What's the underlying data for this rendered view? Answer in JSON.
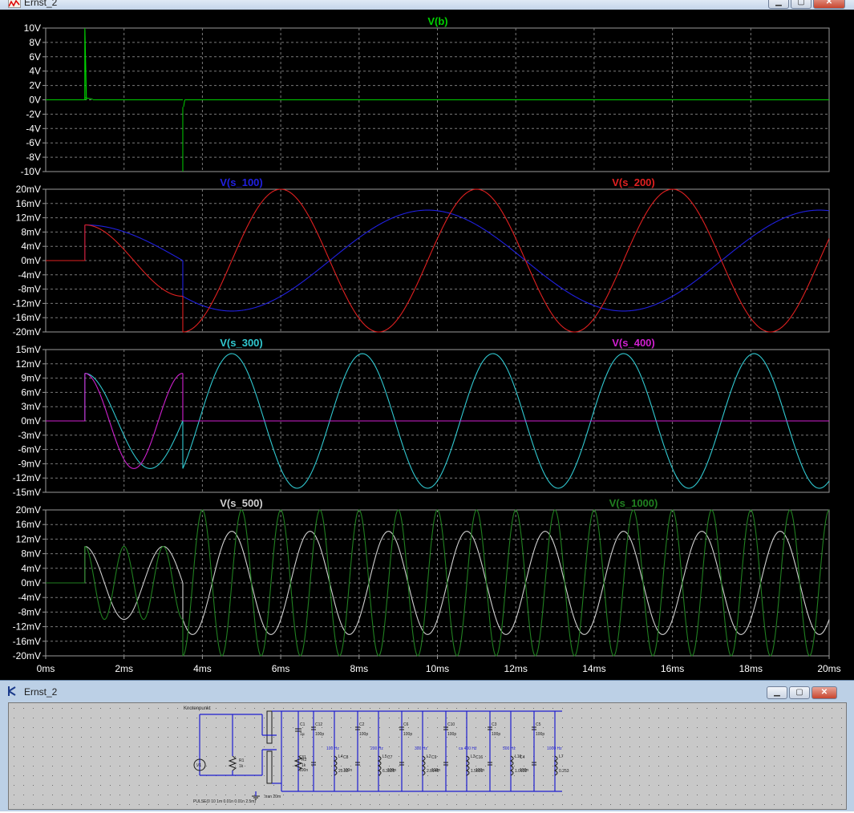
{
  "window": {
    "title": "Ernst_2"
  },
  "colors": {
    "v_b": "#00d000",
    "v_s_100": "#2020e0",
    "v_s_200": "#e02020",
    "v_s_300": "#30c8d0",
    "v_s_400": "#d020d0",
    "v_s_500": "#d0d0d0",
    "v_s_1000": "#208020",
    "grid": "#7a7a7a",
    "axis_text": "#ffffff"
  },
  "plot": {
    "x_axis": {
      "min": 0,
      "max": 20,
      "unit": "ms",
      "ticks": [
        "0ms",
        "2ms",
        "4ms",
        "6ms",
        "8ms",
        "10ms",
        "12ms",
        "14ms",
        "16ms",
        "18ms",
        "20ms"
      ]
    },
    "panes": [
      {
        "traces": [
          "V(b)"
        ],
        "y_ticks": [
          "10V",
          "8V",
          "6V",
          "4V",
          "2V",
          "0V",
          "-2V",
          "-4V",
          "-6V",
          "-8V",
          "-10V"
        ],
        "ylim": [
          -10,
          10
        ]
      },
      {
        "traces": [
          "V(s_100)",
          "V(s_200)"
        ],
        "y_ticks": [
          "20mV",
          "16mV",
          "12mV",
          "8mV",
          "4mV",
          "0mV",
          "-4mV",
          "-8mV",
          "-12mV",
          "-16mV",
          "-20mV"
        ],
        "ylim": [
          -20,
          20
        ]
      },
      {
        "traces": [
          "V(s_300)",
          "V(s_400)"
        ],
        "y_ticks": [
          "15mV",
          "12mV",
          "9mV",
          "6mV",
          "3mV",
          "0mV",
          "-3mV",
          "-6mV",
          "-9mV",
          "-12mV",
          "-15mV"
        ],
        "ylim": [
          -15,
          15
        ]
      },
      {
        "traces": [
          "V(s_500)",
          "V(s_1000)"
        ],
        "y_ticks": [
          "20mV",
          "16mV",
          "12mV",
          "8mV",
          "4mV",
          "0mV",
          "-4mV",
          "-8mV",
          "-12mV",
          "-16mV",
          "-20mV"
        ],
        "ylim": [
          -20,
          20
        ]
      }
    ]
  },
  "chart_data": {
    "type": "line",
    "x_unit": "ms",
    "xlim": [
      0,
      20
    ],
    "series": [
      {
        "name": "V(b)",
        "unit": "V",
        "description": "pulse 10V at 1ms, -10V spike at 3.5ms, otherwise 0V"
      },
      {
        "name": "V(s_100)",
        "unit": "mV",
        "peak": 14,
        "freq_hz": 100
      },
      {
        "name": "V(s_200)",
        "unit": "mV",
        "peak": 20,
        "freq_hz": 200
      },
      {
        "name": "V(s_300)",
        "unit": "mV",
        "peak": 14,
        "freq_hz": 300
      },
      {
        "name": "V(s_400)",
        "unit": "mV",
        "peak": 10,
        "freq_hz": 400
      },
      {
        "name": "V(s_500)",
        "unit": "mV",
        "peak": 14,
        "freq_hz": 500
      },
      {
        "name": "V(s_1000)",
        "unit": "mV",
        "peak": 20,
        "freq_hz": 1000
      }
    ]
  },
  "schematic": {
    "labels": {
      "node": "Knotenpunkt",
      "source": "V1",
      "r1": "R1",
      "r1v": "1k",
      "c1": "C1",
      "c1v": "1µ",
      "r2": "R2",
      "r2v": "1k",
      "tran": ".tran 20m",
      "pulse": "PULSE(0 10 1m 0.01n 0.01n 2.5m)"
    },
    "resonators": [
      {
        "hz": "100 Hz",
        "cap": "C12",
        "c": "C11",
        "ind": "L4",
        "lval": "25.33",
        "c_val": "100p",
        "cv": "100n"
      },
      {
        "hz": "200 Hz",
        "cap": "C2",
        "c": "C8",
        "ind": "L5",
        "lval": "6.3325",
        "c_val": "100p",
        "cv": "100n"
      },
      {
        "hz": "300 Hz",
        "cap": "C6",
        "c": "C7",
        "ind": "L2",
        "lval": "2.8145",
        "c_val": "100p",
        "cv": "100n"
      },
      {
        "hz": "ca 400 Hz",
        "cap": "C10",
        "c": "C9",
        "ind": "L3",
        "lval": "1.5831",
        "c_val": "100p",
        "cv": "100n"
      },
      {
        "hz": "500 Hz",
        "cap": "C3",
        "c": "C16",
        "ind": "L16",
        "lval": "1.0132",
        "c_val": "100p",
        "cv": "100n"
      },
      {
        "hz": "1000 Hz",
        "cap": "C5",
        "c": "C4",
        "ind": "L7",
        "lval": "0.253",
        "c_val": "100p",
        "cv": "100n"
      }
    ]
  }
}
